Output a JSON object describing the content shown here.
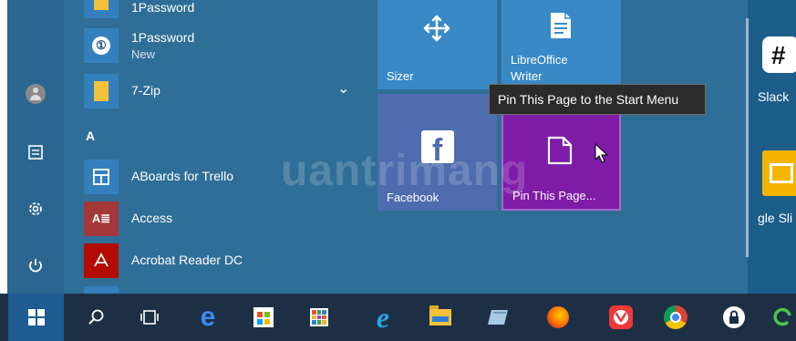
{
  "apps": [
    {
      "name": "1Password",
      "sub": ""
    },
    {
      "name": "1Password",
      "sub": "New"
    },
    {
      "name": "7-Zip",
      "sub": ""
    },
    {
      "name": "ABoards for Trello",
      "sub": ""
    },
    {
      "name": "Access",
      "sub": ""
    },
    {
      "name": "Acrobat Reader DC",
      "sub": ""
    }
  ],
  "section_letter": "A",
  "tiles": {
    "sizer": "Sizer",
    "libreoffice_line1": "LibreOffice",
    "libreoffice_line2": "Writer",
    "facebook": "Facebook",
    "pin_this_page": "Pin This Page..."
  },
  "right_partial": {
    "slack": "Slack",
    "slides": "gle Sli"
  },
  "tooltip": "Pin This Page to the Start Menu",
  "watermark": "uantrimang",
  "colors": {
    "start_bg": "#2f6e97",
    "tile_blue": "#3889c6",
    "tile_purple": "#7e1ca8",
    "taskbar": "#1d2f44",
    "accent": "#1e5c92"
  }
}
